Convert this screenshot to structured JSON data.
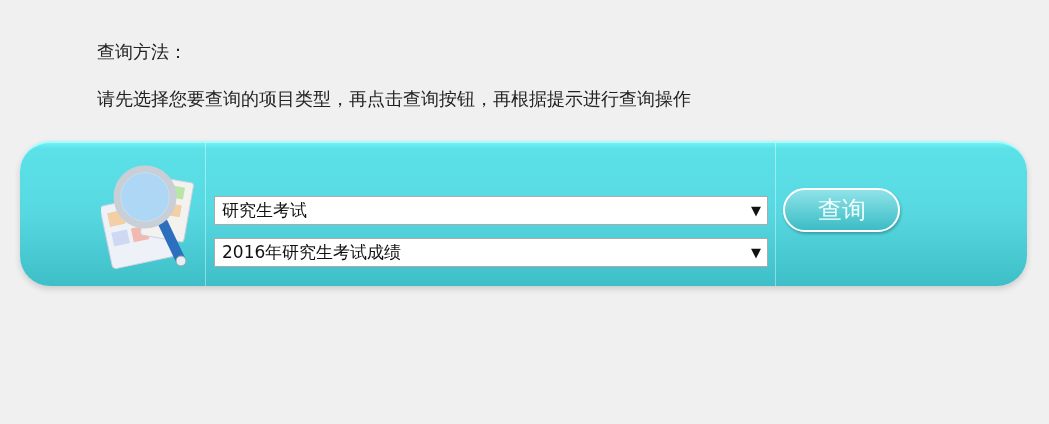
{
  "instructions": {
    "title": "查询方法：",
    "text": "请先选择您要查询的项目类型，再点击查询按钮，再根据提示进行查询操作"
  },
  "query_panel": {
    "selects": [
      {
        "value": "研究生考试",
        "arrow": "▼"
      },
      {
        "value": "2016年研究生考试成绩",
        "arrow": "▼"
      }
    ],
    "button": "查询"
  }
}
